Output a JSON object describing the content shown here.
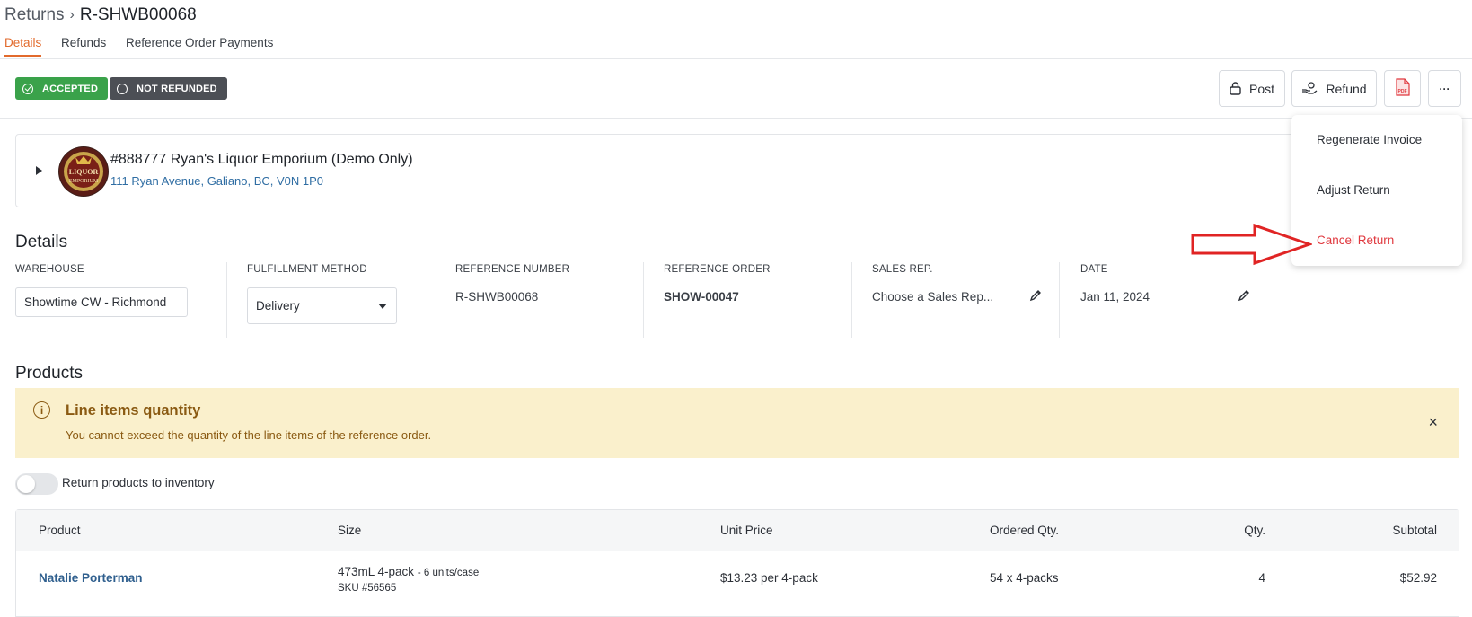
{
  "breadcrumb": {
    "root": "Returns",
    "separator": "›",
    "current": "R-SHWB00068"
  },
  "tabs": [
    {
      "label": "Details",
      "active": true
    },
    {
      "label": "Refunds",
      "active": false
    },
    {
      "label": "Reference Order Payments",
      "active": false
    }
  ],
  "badges": {
    "accepted": "ACCEPTED",
    "not_refunded": "NOT REFUNDED"
  },
  "toolbar": {
    "post_label": "Post",
    "refund_label": "Refund",
    "pdf_label": "PDF",
    "more_label": "···"
  },
  "menu": {
    "items": [
      {
        "label": "Regenerate Invoice"
      },
      {
        "label": "Adjust Return"
      },
      {
        "label": "Cancel Return"
      }
    ]
  },
  "customer": {
    "name": "#888777 Ryan's Liquor Emporium (Demo Only)",
    "address": "111 Ryan Avenue, Galiano, BC, V0N 1P0",
    "logo_text_top": "LIQUOR",
    "logo_text_bottom": "EMPORIUM"
  },
  "details": {
    "title": "Details",
    "warehouse": {
      "label": "WAREHOUSE",
      "value": "Showtime CW - Richmond"
    },
    "fulfillment": {
      "label": "FULFILLMENT METHOD",
      "value": "Delivery"
    },
    "reference_number": {
      "label": "REFERENCE NUMBER",
      "value": "R-SHWB00068"
    },
    "reference_order": {
      "label": "REFERENCE ORDER",
      "value": "SHOW-00047"
    },
    "sales_rep": {
      "label": "SALES REP.",
      "placeholder": "Choose a Sales Rep..."
    },
    "date": {
      "label": "DATE",
      "value": "Jan 11, 2024"
    }
  },
  "products": {
    "title": "Products",
    "alert": {
      "title": "Line items quantity",
      "text": "You cannot exceed the quantity of the line items of the reference order.",
      "close": "×"
    },
    "toggle_label": "Return products to inventory",
    "columns": {
      "product": "Product",
      "size": "Size",
      "unit_price": "Unit Price",
      "ordered_qty": "Ordered Qty.",
      "qty": "Qty.",
      "subtotal": "Subtotal"
    },
    "rows": [
      {
        "product": "Natalie Porterman",
        "size": "473mL 4-pack",
        "units": "- 6 units/case",
        "sku": "SKU #56565",
        "unit_price": "$13.23 per 4-pack",
        "ordered_qty": "54 x 4-packs",
        "qty": "4",
        "subtotal": "$52.92"
      }
    ]
  },
  "colors": {
    "accent": "#e26a2c",
    "accepted": "#3aa24a",
    "not_refunded": "#4c4f55",
    "danger": "#e0383e",
    "alert_bg": "#faf0cc",
    "annotation_arrow": "#e02424"
  }
}
